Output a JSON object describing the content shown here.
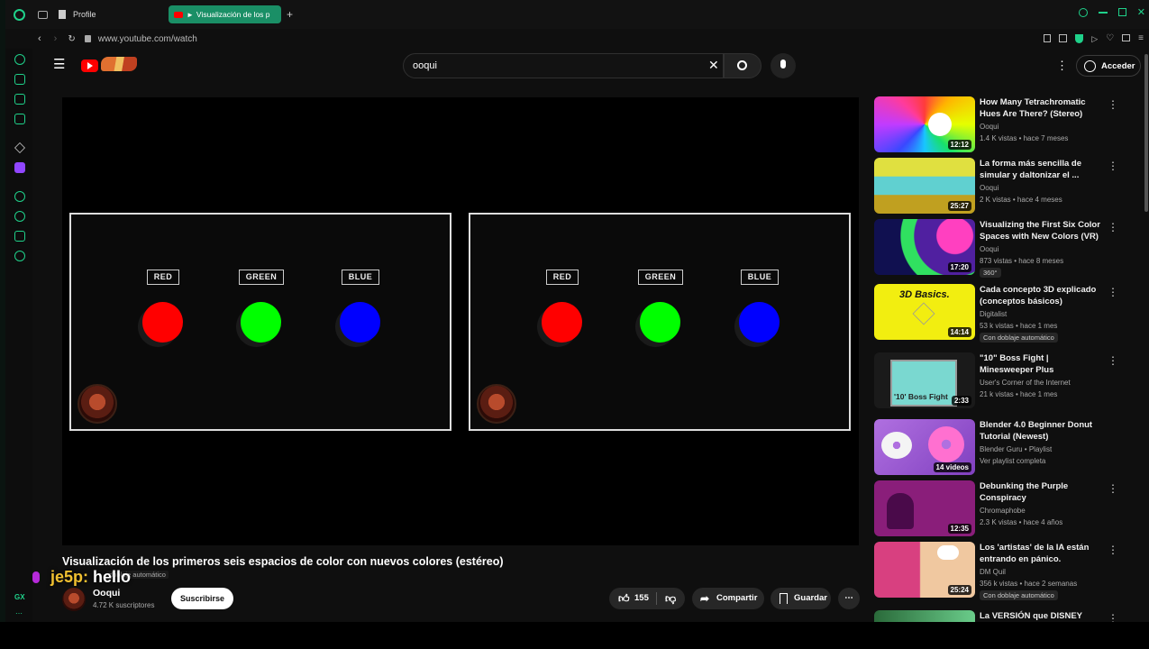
{
  "browser": {
    "tabs": [
      {
        "label": "Profile"
      },
      {
        "label": "Visualización de los p"
      }
    ],
    "new_tab": "+",
    "url": "www.youtube.com/watch"
  },
  "header": {
    "search_value": "ooqui",
    "signin": "Acceder"
  },
  "player": {
    "panels": [
      {
        "labels": [
          "RED",
          "GREEN",
          "BLUE"
        ]
      },
      {
        "labels": [
          "RED",
          "GREEN",
          "BLUE"
        ]
      }
    ],
    "colors": {
      "red": "#ff0000",
      "green": "#00ff00",
      "blue": "#0000ff"
    }
  },
  "video": {
    "title": "Visualización de los primeros seis espacios de color con nuevos colores (estéreo)",
    "channel": "Ooqui",
    "subscribers": "4.72 K suscriptores",
    "subscribe": "Suscribirse",
    "likes": "155",
    "share": "Compartir",
    "save": "Guardar",
    "auto_dub_note": "doblaje automático"
  },
  "overlay": {
    "user": "je5p:",
    "message": "hello"
  },
  "related": [
    {
      "title": "How Many Tetrachromatic Hues Are There? (Stereo)",
      "channel": "Ooqui",
      "meta": "1.4 K vistas • hace 7 meses",
      "duration": "12:12"
    },
    {
      "title": "La forma más sencilla de simular y daltonizar el ...",
      "channel": "Ooqui",
      "meta": "2 K vistas • hace 4 meses",
      "duration": "25:27"
    },
    {
      "title": "Visualizing the First Six Color Spaces with New Colors (VR)",
      "channel": "Ooqui",
      "meta": "873 vistas • hace 8 meses",
      "duration": "17:20",
      "tag": "360°"
    },
    {
      "title": "Cada concepto 3D explicado (conceptos básicos)",
      "channel": "Digitalist",
      "meta": "53 k vistas • hace 1 mes",
      "duration": "14:14",
      "tag": "Con doblaje automático",
      "thumb_text": "3D Basics."
    },
    {
      "title": "\"10\" Boss Fight | Minesweeper Plus",
      "channel": "User's Corner of the Internet",
      "meta": "21 k vistas • hace 1 mes",
      "duration": "2:33",
      "thumb_text": "'10' Boss Fight"
    },
    {
      "title": "Blender 4.0 Beginner Donut Tutorial (Newest)",
      "channel": "Blender Guru • Playlist",
      "meta": "Ver playlist completa",
      "duration": "14 videos"
    },
    {
      "title": "Debunking the Purple Conspiracy",
      "channel": "Chromaphobe",
      "meta": "2.3 K vistas • hace 4 años",
      "duration": "12:35"
    },
    {
      "title": "Los 'artistas' de la IA están entrando en pánico.",
      "channel": "DM Quil",
      "meta": "356 k vistas • hace 2 semanas",
      "duration": "25:24",
      "tag": "Con doblaje automático"
    },
    {
      "title": "La VERSIÓN que DISNEY nunca",
      "channel": "",
      "meta": "",
      "duration": ""
    }
  ]
}
